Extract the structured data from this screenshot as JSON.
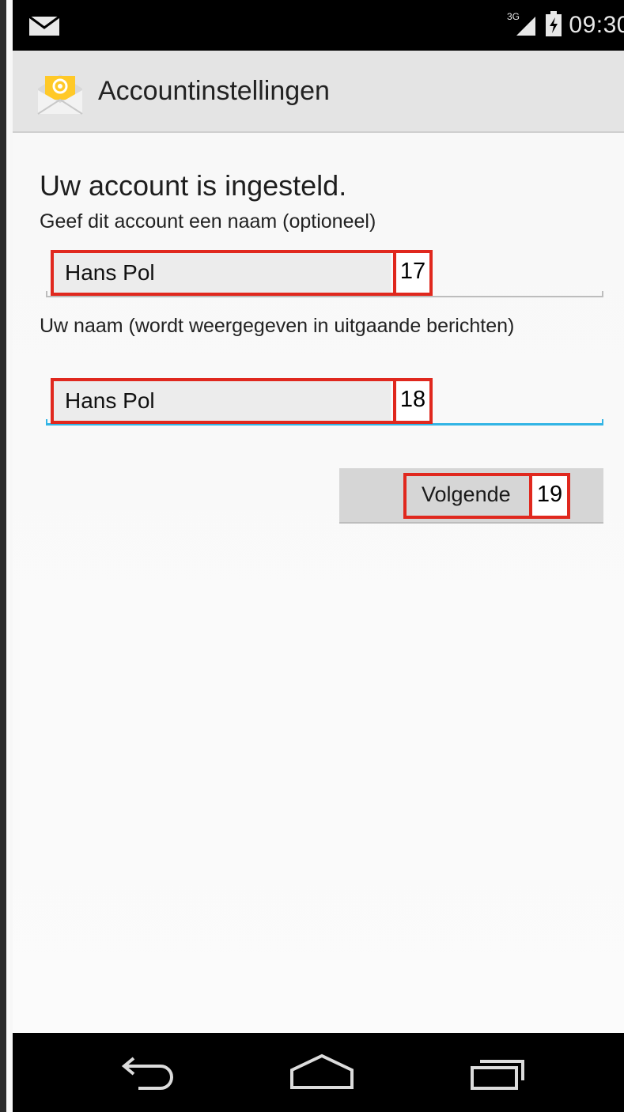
{
  "status_bar": {
    "network": "3G",
    "time": "09:30",
    "icons": [
      "mail-icon",
      "signal-icon",
      "battery-icon"
    ]
  },
  "action_bar": {
    "icon": "email-app-icon",
    "title": "Accountinstellingen"
  },
  "form": {
    "heading": "Uw account is ingesteld.",
    "account_name": {
      "label": "Geef dit account een naam (optioneel)",
      "value": "Hans Pol"
    },
    "your_name": {
      "label": "Uw naam (wordt weergegeven in uitgaande berichten)",
      "value": "Hans Pol"
    },
    "next_button": "Volgende"
  },
  "annotations": {
    "account_name_tag": "17",
    "your_name_tag": "18",
    "next_button_tag": "19"
  },
  "nav_bar": {
    "icons": [
      "back-icon",
      "home-icon",
      "recent-apps-icon"
    ]
  },
  "colors": {
    "accent": "#33b5e5",
    "annotation": "#e0281e"
  }
}
